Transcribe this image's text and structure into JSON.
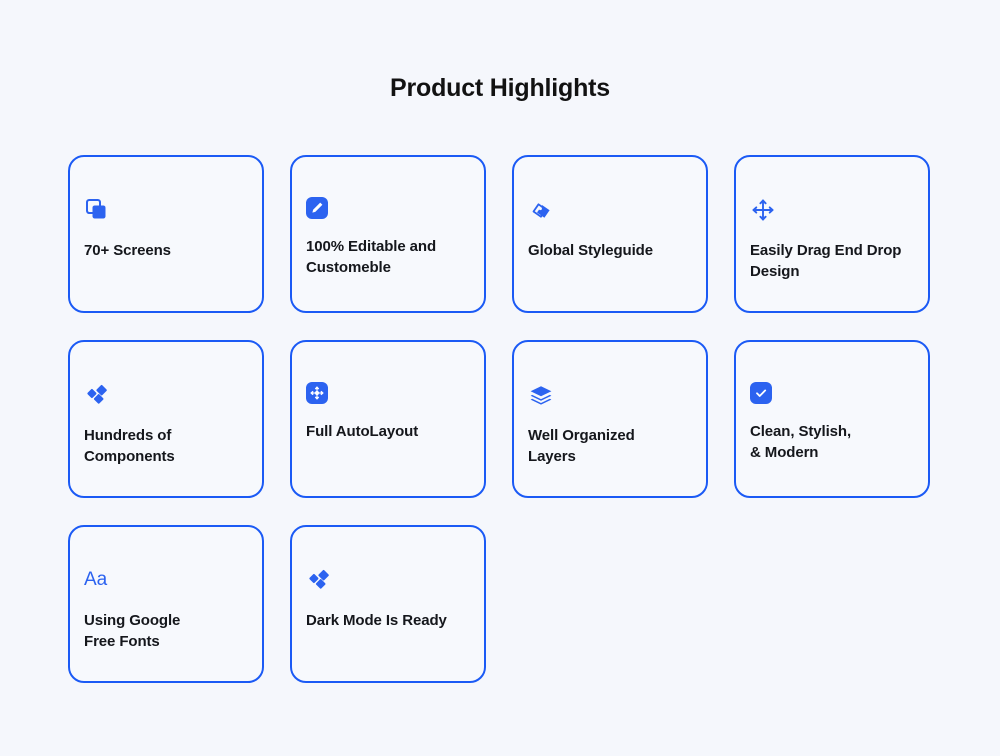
{
  "header": {
    "title": "Product Highlights"
  },
  "theme": {
    "page_background": "#F5F7FC",
    "card_background": "#F7F9FD",
    "card_border": "#1B5AF5",
    "icon_blue": "#2C63F0",
    "text_color": "#15171C"
  },
  "cards": [
    {
      "label": "70+ Screens",
      "icon": "copy-squares-icon",
      "icon_style": "outline"
    },
    {
      "label": "100% Editable and\nCustomeble",
      "icon": "pencil-edit-icon",
      "icon_style": "boxed"
    },
    {
      "label": "Global Styleguide",
      "icon": "tag-label-icon",
      "icon_style": "outline"
    },
    {
      "label": "Easily Drag End Drop\nDesign",
      "icon": "move-arrows-icon",
      "icon_style": "outline"
    },
    {
      "label": "Hundreds of\nComponents",
      "icon": "diamond-cluster-icon",
      "icon_style": "outline"
    },
    {
      "label": "Full AutoLayout",
      "icon": "autolayout-expand-icon",
      "icon_style": "boxed"
    },
    {
      "label": "Well Organized\nLayers",
      "icon": "layers-stack-icon",
      "icon_style": "outline"
    },
    {
      "label": "Clean, Stylish,\n& Modern",
      "icon": "checkbox-checked-icon",
      "icon_style": "boxed"
    },
    {
      "label": "Using Google\nFree Fonts",
      "icon": "typography-aa-icon",
      "icon_style": "glyph",
      "glyph": "Aa"
    },
    {
      "label": "Dark Mode Is Ready",
      "icon": "diamond-cluster-icon",
      "icon_style": "outline"
    }
  ]
}
